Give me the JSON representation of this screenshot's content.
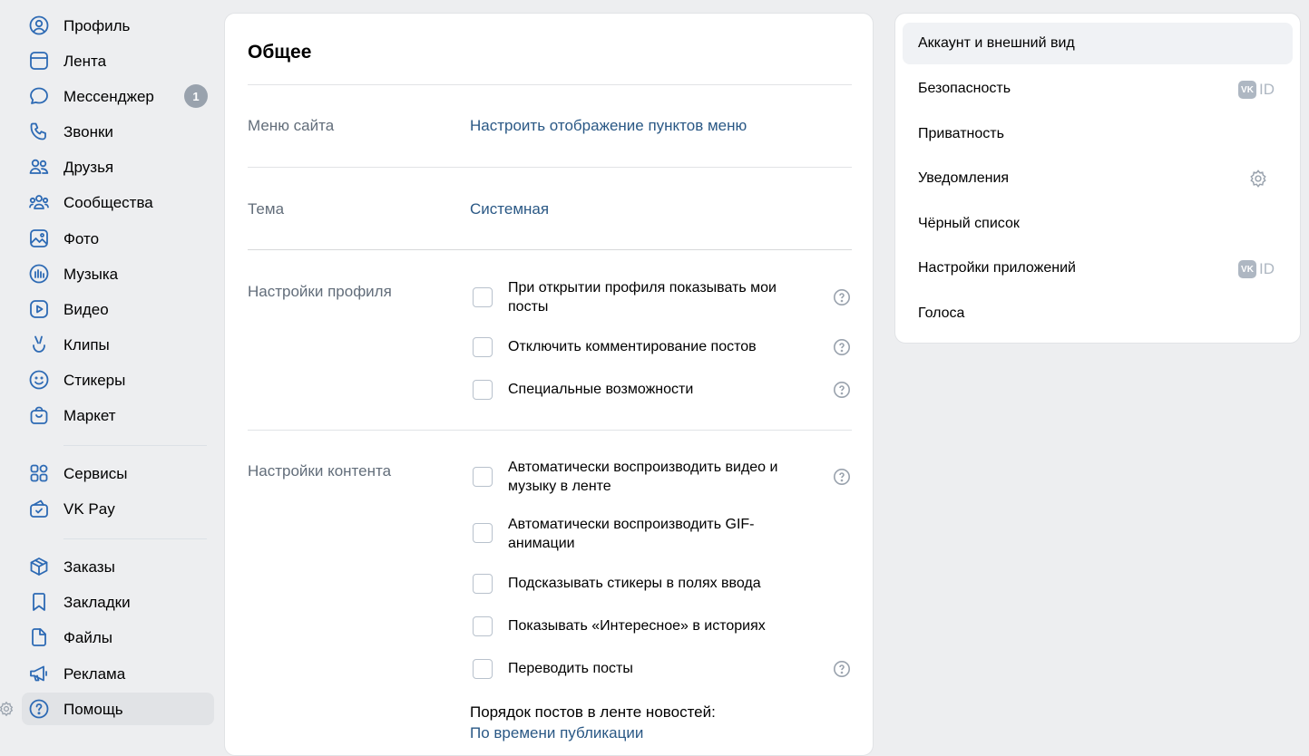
{
  "nav": {
    "items": [
      {
        "label": "Профиль",
        "icon": "user-circle-icon"
      },
      {
        "label": "Лента",
        "icon": "news-feed-icon"
      },
      {
        "label": "Мессенджер",
        "icon": "message-icon",
        "badge": "1"
      },
      {
        "label": "Звонки",
        "icon": "phone-icon"
      },
      {
        "label": "Друзья",
        "icon": "friends-icon"
      },
      {
        "label": "Сообщества",
        "icon": "communities-icon"
      },
      {
        "label": "Фото",
        "icon": "photo-icon"
      },
      {
        "label": "Музыка",
        "icon": "music-icon"
      },
      {
        "label": "Видео",
        "icon": "video-icon"
      },
      {
        "label": "Клипы",
        "icon": "clips-icon"
      },
      {
        "label": "Стикеры",
        "icon": "smile-icon"
      },
      {
        "label": "Маркет",
        "icon": "market-bag-icon"
      },
      {
        "label": "Сервисы",
        "icon": "services-grid-icon"
      },
      {
        "label": "VK Pay",
        "icon": "wallet-icon"
      },
      {
        "label": "Заказы",
        "icon": "box-icon"
      },
      {
        "label": "Закладки",
        "icon": "bookmark-icon"
      },
      {
        "label": "Файлы",
        "icon": "file-icon"
      },
      {
        "label": "Реклама",
        "icon": "megaphone-icon"
      },
      {
        "label": "Помощь",
        "icon": "question-circle-icon",
        "active": true
      }
    ]
  },
  "main": {
    "title": "Общее",
    "site_menu": {
      "label": "Меню сайта",
      "link": "Настроить отображение пунктов меню"
    },
    "theme": {
      "label": "Тема",
      "value": "Системная"
    },
    "profile": {
      "label": "Настройки профиля",
      "options": [
        {
          "text": "При открытии профиля показывать мои посты",
          "checked": false,
          "help": true
        },
        {
          "text": "Отключить комментирование постов",
          "checked": false,
          "help": true
        },
        {
          "text": "Специальные возможности",
          "checked": false,
          "help": true
        }
      ]
    },
    "content": {
      "label": "Настройки контента",
      "options": [
        {
          "text": "Автоматически воспроизводить видео и музыку в ленте",
          "checked": false,
          "help": true
        },
        {
          "text": "Автоматически воспроизводить GIF-анимации",
          "checked": false,
          "help": false
        },
        {
          "text": "Подсказывать стикеры в полях ввода",
          "checked": false,
          "help": false
        },
        {
          "text": "Показывать «Интересное» в историях",
          "checked": false,
          "help": false
        },
        {
          "text": "Переводить посты",
          "checked": false,
          "help": true
        }
      ],
      "order_title": "Порядок постов в ленте новостей:",
      "order_value": "По времени публикации"
    }
  },
  "side": {
    "items": [
      {
        "label": "Аккаунт и внешний вид",
        "active": true
      },
      {
        "label": "Безопасность",
        "badge": "vkid"
      },
      {
        "label": "Приватность"
      },
      {
        "label": "Уведомления",
        "badge": "gear"
      },
      {
        "label": "Чёрный список"
      },
      {
        "label": "Настройки приложений",
        "badge": "vkid"
      },
      {
        "label": "Голоса"
      }
    ],
    "vkid_logo": "VK",
    "vkid_text": "ID"
  },
  "colors": {
    "accent": "#2d6ab4",
    "link": "#2a5885",
    "muted": "#626d7a",
    "background": "#edeef0"
  }
}
